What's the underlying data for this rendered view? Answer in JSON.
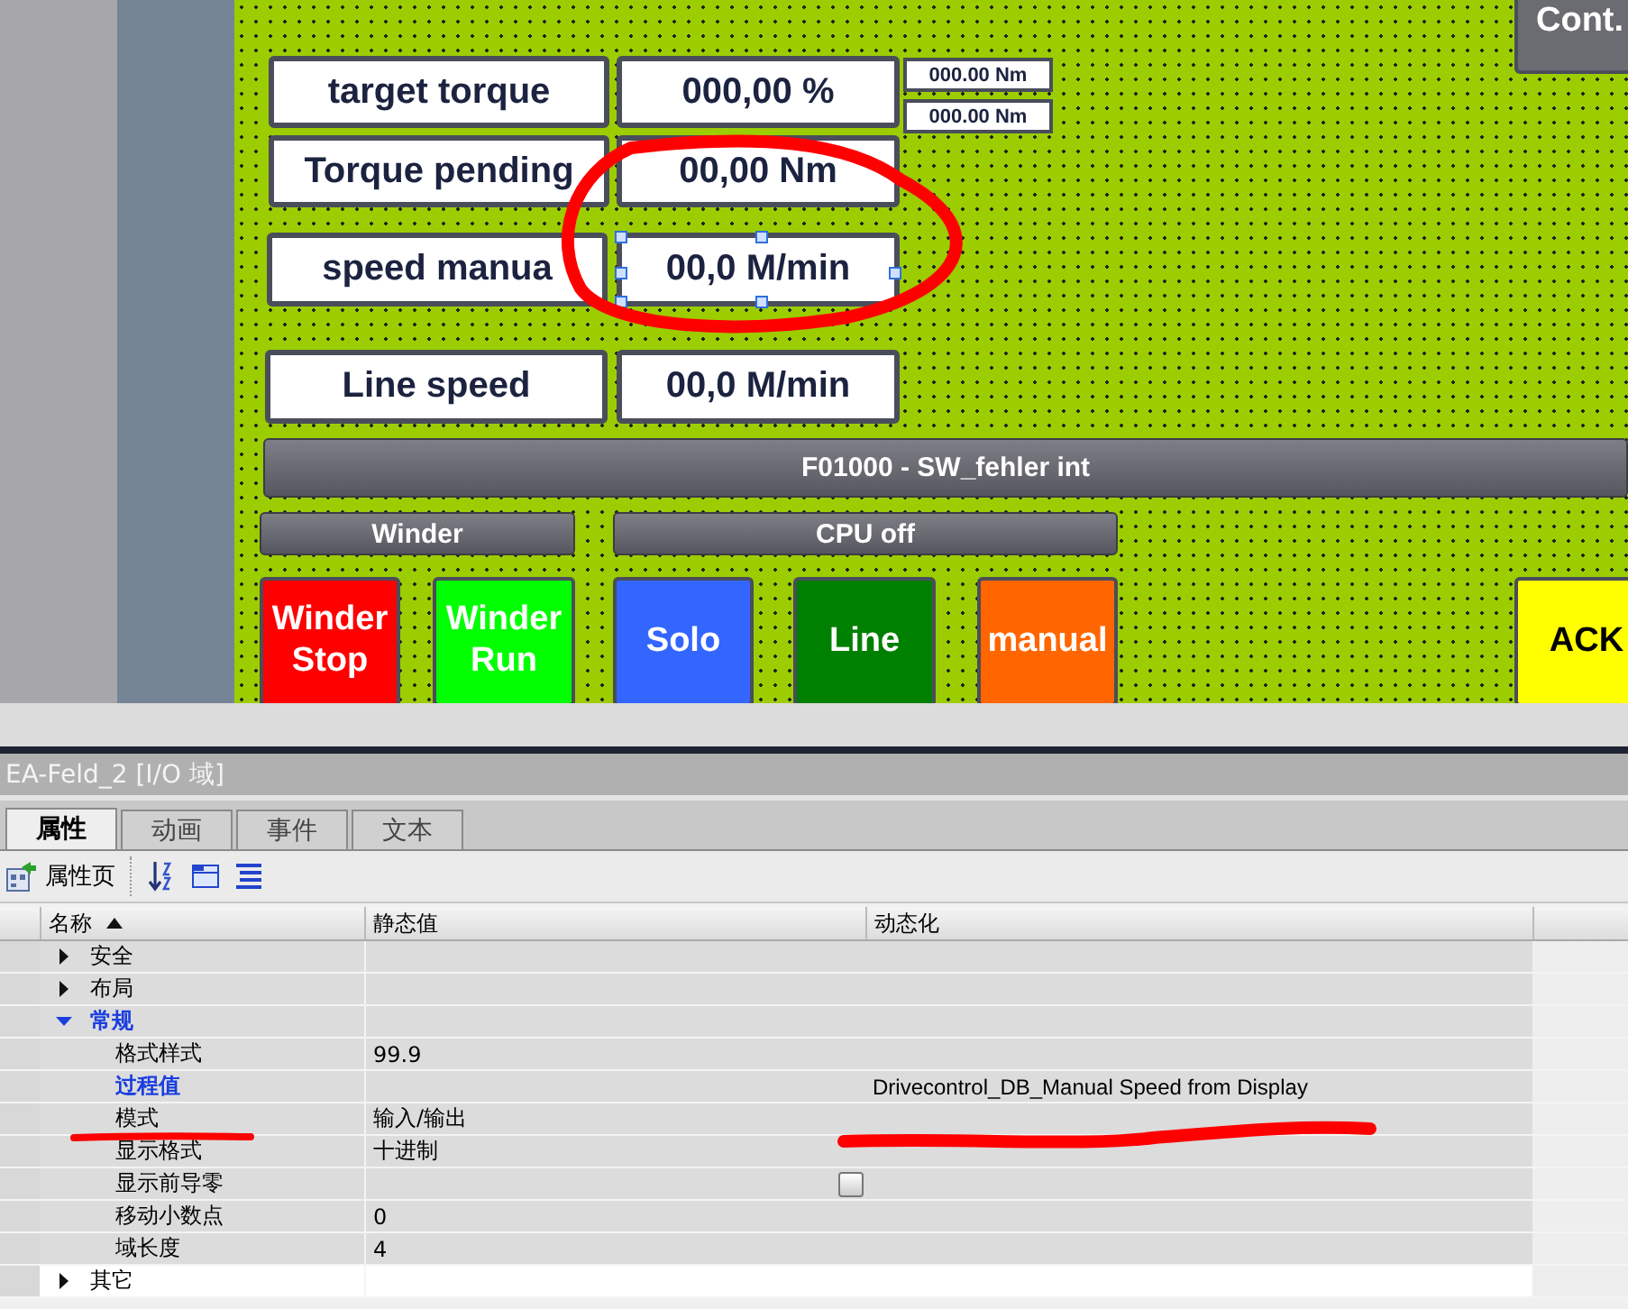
{
  "hmi_screen": {
    "items": [
      {
        "kind": "label",
        "text": "target torque"
      },
      {
        "kind": "io-field",
        "text": "000,00  %",
        "selected": false
      },
      {
        "kind": "small-field",
        "text": "000.00 Nm"
      },
      {
        "kind": "small-field",
        "text": "000.00 Nm"
      },
      {
        "kind": "label",
        "text": "Torque pending"
      },
      {
        "kind": "io-field",
        "text": "00,00  Nm",
        "selected": false
      },
      {
        "kind": "label",
        "text": "speed manua"
      },
      {
        "kind": "io-field",
        "text": "00,0  M/min",
        "selected": true
      },
      {
        "kind": "label",
        "text": "Line speed"
      },
      {
        "kind": "io-field",
        "text": "00,0  M/min",
        "selected": false
      },
      {
        "kind": "bar",
        "text": "F01000 - SW_fehler int"
      },
      {
        "kind": "bar",
        "text": "Winder"
      },
      {
        "kind": "bar",
        "text": "CPU off"
      },
      {
        "kind": "button",
        "text": "Winder Stop",
        "color": "#ff0000"
      },
      {
        "kind": "button",
        "text": "Winder Run",
        "color": "#00ff00"
      },
      {
        "kind": "button",
        "text": "Solo",
        "color": "#3366ff"
      },
      {
        "kind": "button",
        "text": "Line",
        "color": "#008000"
      },
      {
        "kind": "button",
        "text": "manual",
        "color": "#ff6600"
      },
      {
        "kind": "button",
        "text": "ACK",
        "color": "#ffff00"
      },
      {
        "kind": "button",
        "text": "Cont.",
        "color": "#6b6b72"
      }
    ]
  },
  "inspector": {
    "title": "EA-Feld_2  [I/O 域]",
    "tabs": [
      {
        "label": "属性",
        "selected": true
      },
      {
        "label": "动画",
        "selected": false
      },
      {
        "label": "事件",
        "selected": false
      },
      {
        "label": "文本",
        "selected": false
      }
    ],
    "toolbar": {
      "label": "属性页"
    },
    "columns": [
      "名称",
      "静态值",
      "动态化"
    ],
    "rows": [
      {
        "name": "安全",
        "expanded": false
      },
      {
        "name": "布局",
        "expanded": false
      },
      {
        "name": "常规",
        "expanded": true,
        "highlighted": true,
        "children": [
          {
            "name": "格式样式",
            "value": "99.9",
            "highlighted": false
          },
          {
            "name": "过程值",
            "dynamic": "Drivecontrol_DB_Manual Speed from Display",
            "highlighted": true
          },
          {
            "name": "模式",
            "value": "输入/输出",
            "highlighted": false
          },
          {
            "name": "显示格式",
            "value": "十进制",
            "highlighted": false
          },
          {
            "name": "显示前导零",
            "kind": "checkbox",
            "checked": false,
            "highlighted": false
          },
          {
            "name": "移动小数点",
            "value": "0",
            "highlighted": false
          },
          {
            "name": "域长度",
            "value": "4",
            "highlighted": false
          }
        ]
      },
      {
        "name": "其它",
        "expanded": false
      }
    ]
  },
  "annotations": [
    {
      "kind": "circle"
    },
    {
      "kind": "short-stroke"
    },
    {
      "kind": "long-stroke"
    }
  ]
}
